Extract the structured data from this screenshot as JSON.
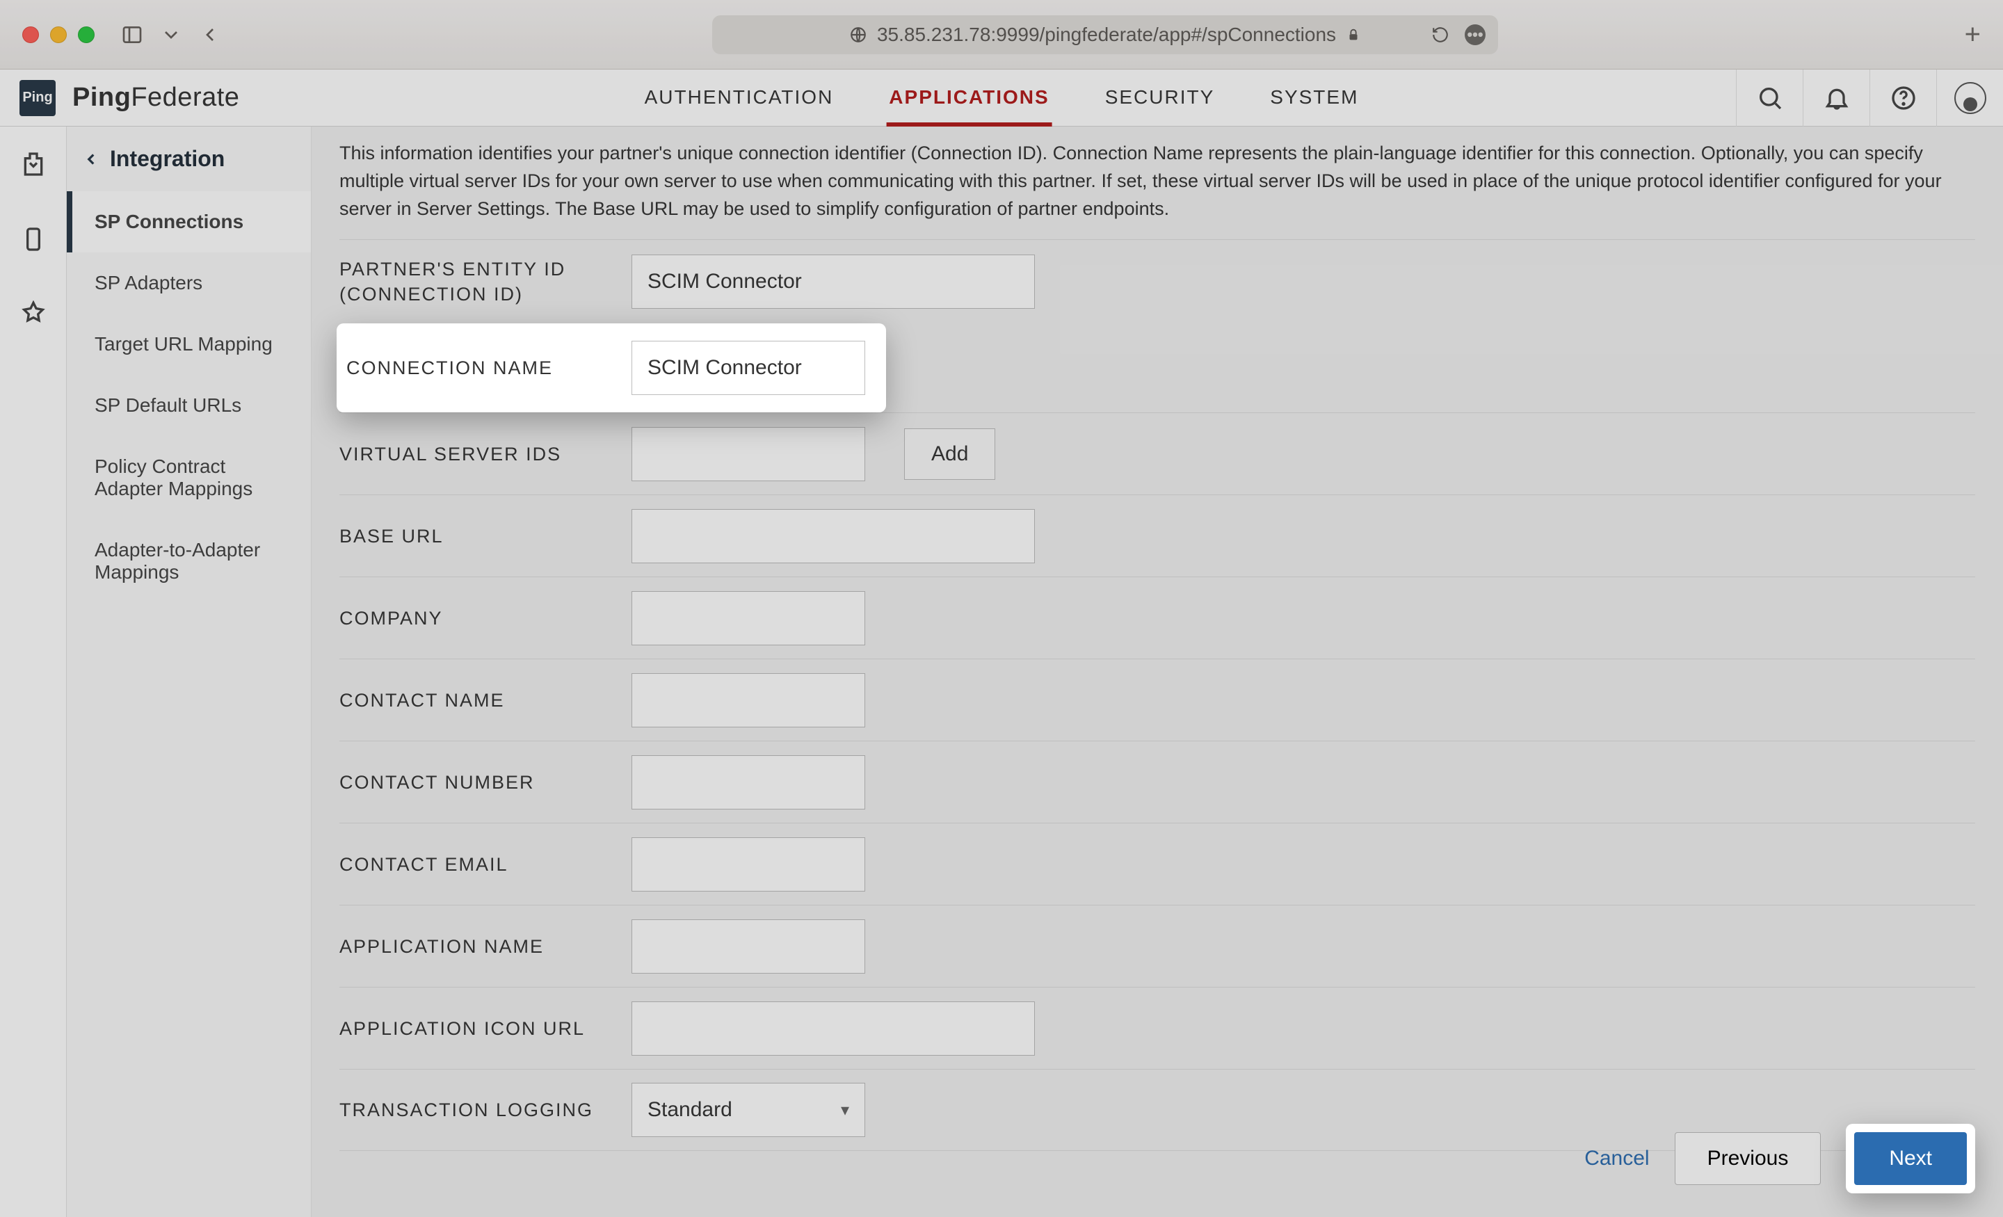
{
  "browser": {
    "url": "35.85.231.78:9999/pingfederate/app#/spConnections"
  },
  "brand": {
    "badge": "Ping",
    "name_bold": "Ping",
    "name_rest": "Federate"
  },
  "topnav": {
    "items": [
      {
        "label": "AUTHENTICATION"
      },
      {
        "label": "APPLICATIONS"
      },
      {
        "label": "SECURITY"
      },
      {
        "label": "SYSTEM"
      }
    ],
    "active_index": 1
  },
  "subnav": {
    "title": "Integration",
    "items": [
      {
        "label": "SP Connections"
      },
      {
        "label": "SP Adapters"
      },
      {
        "label": "Target URL Mapping"
      },
      {
        "label": "SP Default URLs"
      },
      {
        "label": "Policy Contract Adapter Mappings"
      },
      {
        "label": "Adapter-to-Adapter Mappings"
      }
    ],
    "active_index": 0
  },
  "help_text": "This information identifies your partner's unique connection identifier (Connection ID). Connection Name represents the plain-language identifier for this connection. Optionally, you can specify multiple virtual server IDs for your own server to use when communicating with this partner. If set, these virtual server IDs will be used in place of the unique protocol identifier configured for your server in Server Settings. The Base URL may be used to simplify configuration of partner endpoints.",
  "form": {
    "partners_entity_id": {
      "label": "PARTNER'S ENTITY ID (CONNECTION ID)",
      "value": "SCIM Connector"
    },
    "connection_name": {
      "label": "CONNECTION NAME",
      "value": "SCIM Connector"
    },
    "virtual_server_ids": {
      "label": "VIRTUAL SERVER IDS",
      "value": "",
      "add_label": "Add"
    },
    "base_url": {
      "label": "BASE URL",
      "value": ""
    },
    "company": {
      "label": "COMPANY",
      "value": ""
    },
    "contact_name": {
      "label": "CONTACT NAME",
      "value": ""
    },
    "contact_number": {
      "label": "CONTACT NUMBER",
      "value": ""
    },
    "contact_email": {
      "label": "CONTACT EMAIL",
      "value": ""
    },
    "application_name": {
      "label": "APPLICATION NAME",
      "value": ""
    },
    "application_icon_url": {
      "label": "APPLICATION ICON URL",
      "value": ""
    },
    "transaction_logging": {
      "label": "TRANSACTION LOGGING",
      "value": "Standard"
    }
  },
  "footer": {
    "cancel": "Cancel",
    "previous": "Previous",
    "next": "Next"
  }
}
